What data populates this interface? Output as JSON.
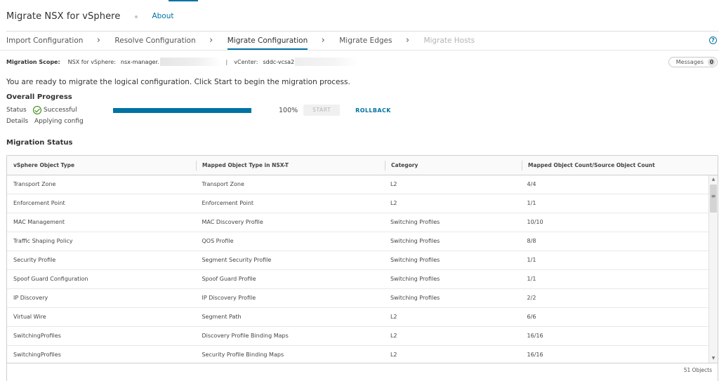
{
  "header": {
    "title": "Migrate NSX for vSphere",
    "about_label": "About"
  },
  "steps": [
    {
      "label": "Import Configuration",
      "state": "done"
    },
    {
      "label": "Resolve Configuration",
      "state": "done"
    },
    {
      "label": "Migrate Configuration",
      "state": "active"
    },
    {
      "label": "Migrate Edges",
      "state": "pending"
    },
    {
      "label": "Migrate Hosts",
      "state": "disabled"
    }
  ],
  "help_icon": "?",
  "scope": {
    "label": "Migration Scope:",
    "nsx_key": "NSX for vSphere:",
    "nsx_value": "nsx-manager.",
    "separator": "|",
    "vcenter_key": "vCenter:",
    "vcenter_value": "sddc-vcsa2"
  },
  "messages": {
    "label": "Messages",
    "count": "0"
  },
  "ready_text": "You are ready to migrate the logical configuration. Click Start to begin the migration process.",
  "progress": {
    "title": "Overall Progress",
    "status_label": "Status",
    "status_value": "Successful",
    "percent": 100,
    "percent_text": "100%",
    "start_label": "START",
    "rollback_label": "ROLLBACK",
    "details_label": "Details",
    "details_value": "Applying config"
  },
  "migration_status": {
    "title": "Migration Status",
    "columns": [
      "vSphere Object Type",
      "Mapped Object Type in NSX-T",
      "Category",
      "Mapped Object Count/Source Object Count"
    ],
    "rows": [
      [
        "Transport Zone",
        "Transport Zone",
        "L2",
        "4/4"
      ],
      [
        "Enforcement Point",
        "Enforcement Point",
        "L2",
        "1/1"
      ],
      [
        "MAC Management",
        "MAC Discovery Profile",
        "Switching Profiles",
        "10/10"
      ],
      [
        "Traffic Shaping Policy",
        "QOS Profile",
        "Switching Profiles",
        "8/8"
      ],
      [
        "Security Profile",
        "Segment Security Profile",
        "Switching Profiles",
        "1/1"
      ],
      [
        "Spoof Guard Configuration",
        "Spoof Guard Profile",
        "Switching Profiles",
        "1/1"
      ],
      [
        "IP Discovery",
        "IP Discovery Profile",
        "Switching Profiles",
        "2/2"
      ],
      [
        "Virtual Wire",
        "Segment Path",
        "L2",
        "6/6"
      ],
      [
        "SwitchingProfiles",
        "Discovery Profile Binding Maps",
        "L2",
        "16/16"
      ],
      [
        "SwitchingProfiles",
        "Security Profile Binding Maps",
        "L2",
        "16/16"
      ]
    ],
    "footer": "51 Objects"
  },
  "colors": {
    "accent": "#0072a3",
    "success": "#2f8400"
  }
}
